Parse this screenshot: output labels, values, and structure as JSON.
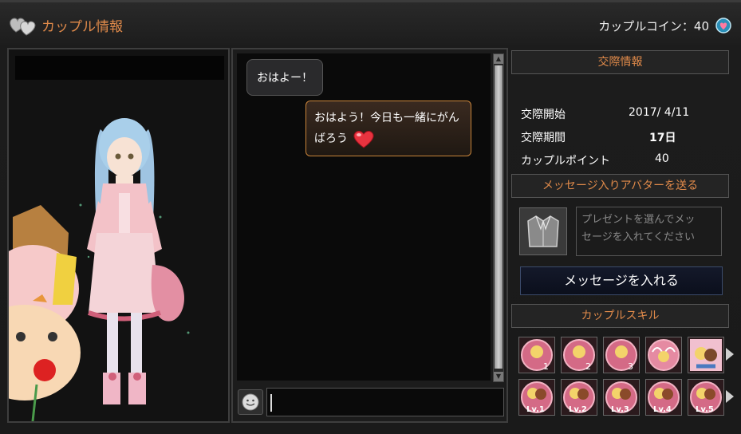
{
  "window": {
    "title": "カップル情報",
    "coin_label": "カップルコイン：40"
  },
  "chat": {
    "messages": [
      {
        "side": "left",
        "text": "おはよー！"
      },
      {
        "side": "right",
        "text_line1": "おはよう！今日も一緒にがん",
        "text_line2": "ばろう"
      }
    ],
    "input_value": ""
  },
  "relationship": {
    "header": "交際情報",
    "rows": [
      {
        "label": "交際開始",
        "value": "2017/ 4/11"
      },
      {
        "label": "交際期間",
        "value": "17日"
      },
      {
        "label": "カップルポイント",
        "value": "40"
      }
    ]
  },
  "send_avatar": {
    "header": "メッセージ入りアバターを送る",
    "placeholder_line1": "プレゼントを選んでメッ",
    "placeholder_line2": "セージを入れてください",
    "button_label": "メッセージを入れる"
  },
  "skills": {
    "header": "カップルスキル",
    "row1": [
      {
        "icon": "couple-skill-1-icon",
        "num": "1"
      },
      {
        "icon": "couple-skill-2-icon",
        "num": "2"
      },
      {
        "icon": "couple-skill-3-icon",
        "num": "3"
      },
      {
        "icon": "couple-skill-angel-icon",
        "num": ""
      },
      {
        "icon": "couple-skill-hug-icon",
        "num": ""
      }
    ],
    "row2": [
      {
        "icon": "couple-skill-lv1-icon",
        "num": "Lv.1"
      },
      {
        "icon": "couple-skill-lv2-icon",
        "num": "Lv.2"
      },
      {
        "icon": "couple-skill-lv3-icon",
        "num": "Lv.3"
      },
      {
        "icon": "couple-skill-lv4-icon",
        "num": "Lv.4"
      },
      {
        "icon": "couple-skill-lv5-icon",
        "num": "Lv.5"
      }
    ]
  },
  "colors": {
    "accent_orange": "#e08a4a",
    "bubble_border": "#c8843a"
  }
}
